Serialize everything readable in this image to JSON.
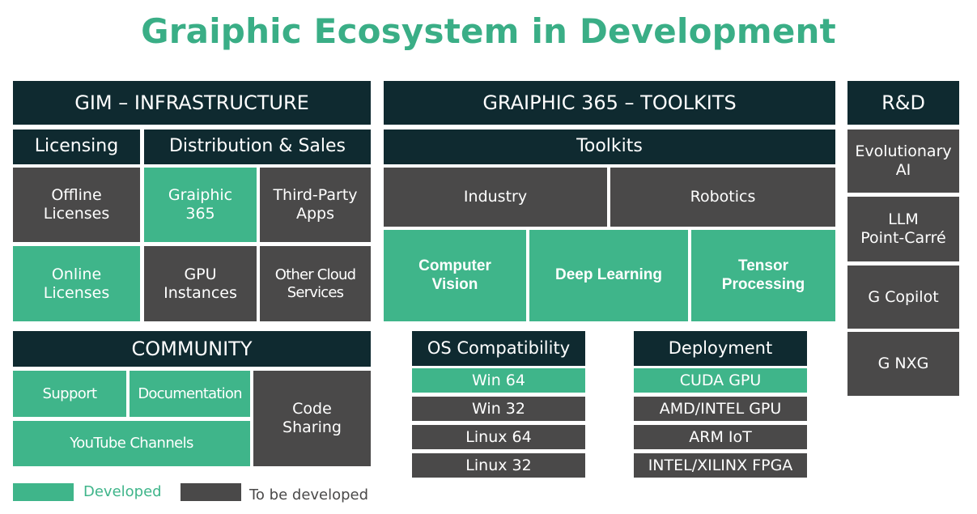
{
  "title": "Graiphic Ecosystem in Development",
  "colors": {
    "dark": "#0f2a30",
    "developed": "#3fb58a",
    "to_be_developed": "#4a4949",
    "title": "#3aae86"
  },
  "gim": {
    "header": "GIM – INFRASTRUCTURE",
    "licensing": "Licensing",
    "distribution": "Distribution & Sales",
    "offline": "Offline\nLicenses",
    "online": "Online\nLicenses",
    "graiphic365": "Graiphic\n365",
    "third_party": "Third-Party\nApps",
    "gpu": "GPU\nInstances",
    "other_cloud": "Other Cloud\nServices"
  },
  "toolkits": {
    "header": "GRAIPHIC 365 – TOOLKITS",
    "sub": "Toolkits",
    "industry": "Industry",
    "robotics": "Robotics",
    "computer_vision": "Computer\nVision",
    "deep_learning": "Deep Learning",
    "tensor": "Tensor\nProcessing"
  },
  "rnd": {
    "header": "R&D",
    "items": [
      "Evolutionary\nAI",
      "LLM\nPoint-Carré",
      "G Copilot",
      "G NXG"
    ]
  },
  "community": {
    "header": "COMMUNITY",
    "support": "Support",
    "documentation": "Documentation",
    "youtube": "YouTube Channels",
    "code_sharing": "Code\nSharing"
  },
  "os": {
    "header": "OS Compatibility",
    "items": [
      "Win 64",
      "Win 32",
      "Linux 64",
      "Linux 32"
    ]
  },
  "deployment": {
    "header": "Deployment",
    "items": [
      "CUDA GPU",
      "AMD/INTEL GPU",
      "ARM IoT",
      "INTEL/XILINX FPGA"
    ]
  },
  "legend": {
    "developed": "Developed",
    "to_be_developed": "To be developed"
  }
}
